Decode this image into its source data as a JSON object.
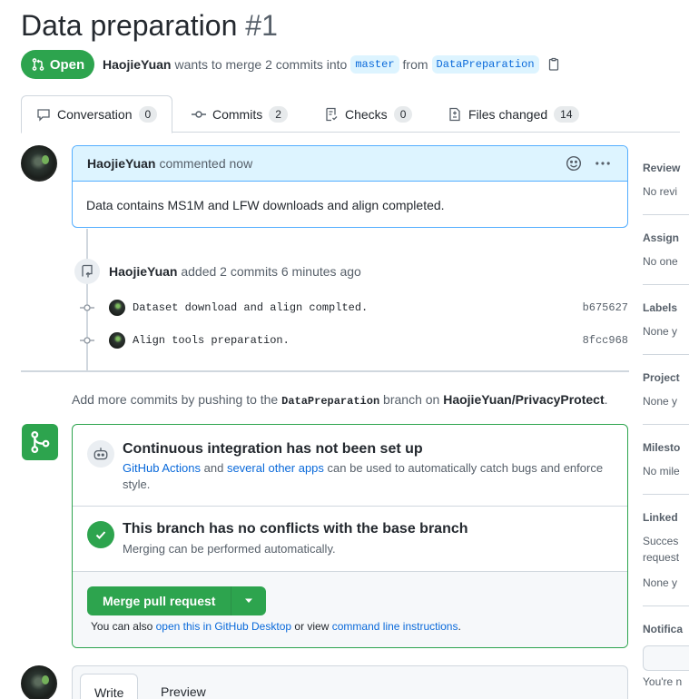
{
  "pr": {
    "title": "Data preparation",
    "number": "#1",
    "state": "Open",
    "author": "HaojieYuan",
    "merge_text": "wants to merge 2 commits into",
    "base_branch": "master",
    "from_text": "from",
    "head_branch": "DataPreparation"
  },
  "tabs": [
    {
      "label": "Conversation",
      "count": "0"
    },
    {
      "label": "Commits",
      "count": "2"
    },
    {
      "label": "Checks",
      "count": "0"
    },
    {
      "label": "Files changed",
      "count": "14"
    }
  ],
  "comment": {
    "author": "HaojieYuan",
    "action": "commented now",
    "body": "Data contains MS1M and LFW downloads and align completed."
  },
  "commit_event": {
    "author": "HaojieYuan",
    "text": "added 2 commits 6 minutes ago"
  },
  "commits": [
    {
      "message": "Dataset download and align complted.",
      "sha": "b675627"
    },
    {
      "message": "Align tools preparation.",
      "sha": "8fcc968"
    }
  ],
  "push_note": {
    "prefix": "Add more commits by pushing to the",
    "branch": "DataPreparation",
    "middle": "branch on",
    "repo": "HaojieYuan/PrivacyProtect",
    "suffix": "."
  },
  "merge_box": {
    "ci_title": "Continuous integration has not been set up",
    "ci_link1": "GitHub Actions",
    "ci_and": "and",
    "ci_link2": "several other apps",
    "ci_rest": "can be used to automatically catch bugs and enforce style.",
    "conflict_title": "This branch has no conflicts with the base branch",
    "conflict_desc": "Merging can be performed automatically.",
    "merge_button": "Merge pull request",
    "also_prefix": "You can also",
    "also_link1": "open this in GitHub Desktop",
    "also_middle": "or view",
    "also_link2": "command line instructions",
    "also_suffix": "."
  },
  "comment_form": {
    "tab_write": "Write",
    "tab_preview": "Preview"
  },
  "sidebar": {
    "sections": [
      {
        "head": "Review",
        "values": [
          "No revi"
        ]
      },
      {
        "head": "Assign",
        "values": [
          "No one"
        ]
      },
      {
        "head": "Labels",
        "values": [
          "None y"
        ]
      },
      {
        "head": "Project",
        "values": [
          "None y"
        ]
      },
      {
        "head": "Milesto",
        "values": [
          "No mile"
        ]
      },
      {
        "head": "Linked",
        "values": [
          "Succes",
          "request",
          "None y"
        ]
      },
      {
        "head": "Notifica",
        "values": [
          "You're n"
        ]
      }
    ]
  },
  "colors": {
    "success": "#2da44e",
    "accent": "#0969da",
    "comment_header_bg": "#ddf4ff",
    "comment_border": "#54aeff"
  }
}
